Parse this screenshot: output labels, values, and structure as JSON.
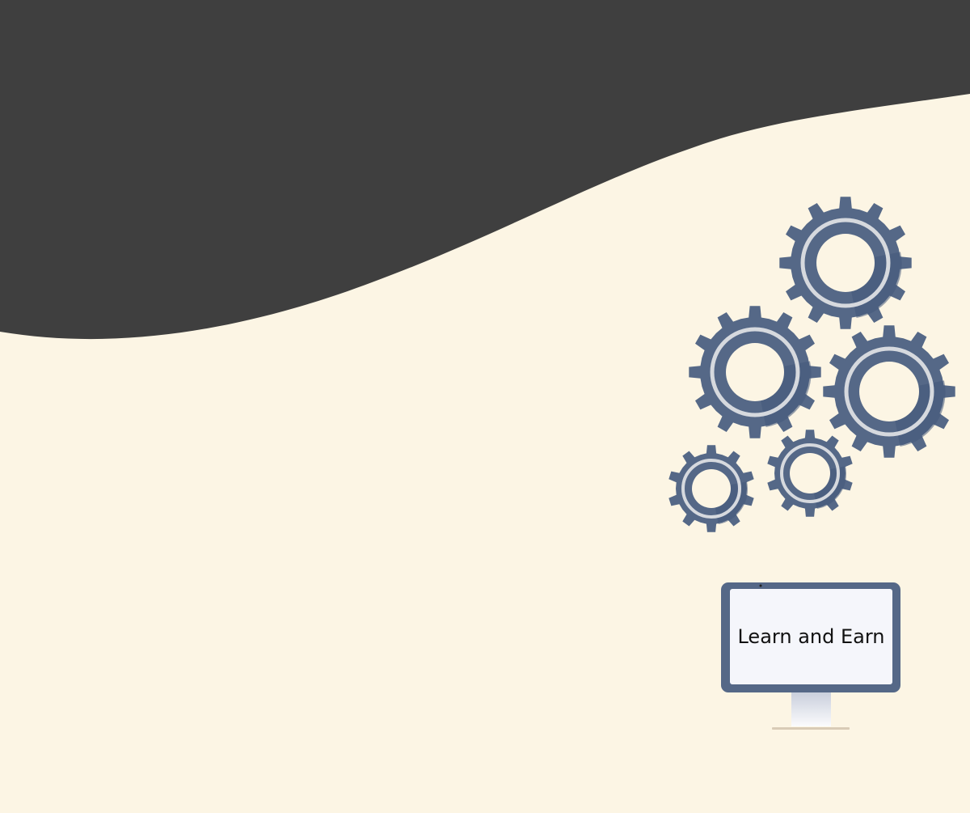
{
  "colors": {
    "background": "#fcf5e4",
    "wave": "#3f3f3f",
    "gear": "#556887",
    "gear_dark": "#44587a",
    "gear_ring": "#d6d9de",
    "monitor_frame": "#556887",
    "monitor_screen": "#f5f6fb",
    "monitor_text": "#111111"
  },
  "icons": [
    "gear-icon",
    "monitor-icon"
  ],
  "monitor": {
    "label": "Learn and Earn"
  }
}
